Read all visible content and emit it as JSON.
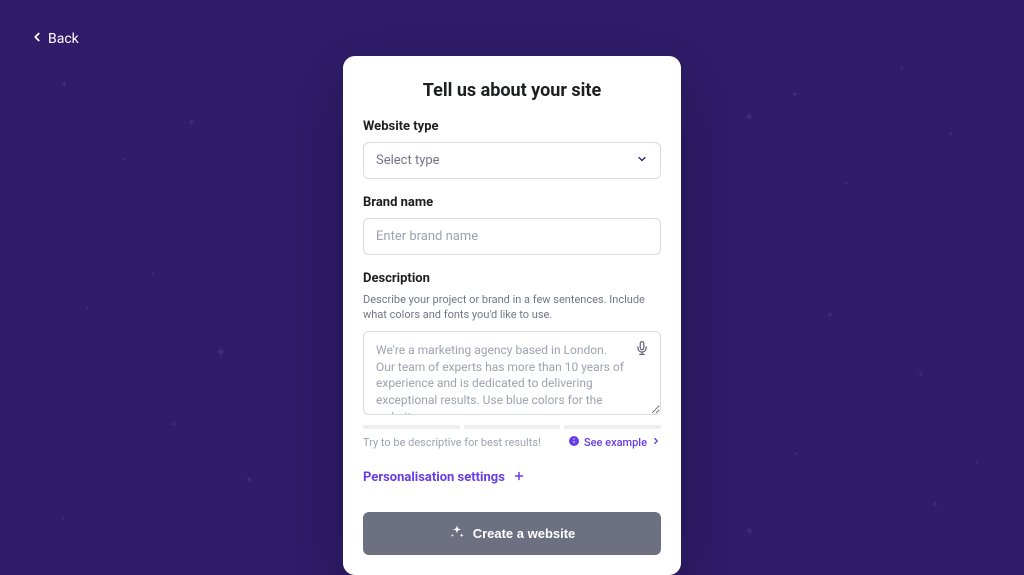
{
  "back_label": "Back",
  "card": {
    "title": "Tell us about your site",
    "website_type": {
      "label": "Website type",
      "placeholder": "Select type"
    },
    "brand_name": {
      "label": "Brand name",
      "placeholder": "Enter brand name"
    },
    "description": {
      "label": "Description",
      "sublabel": "Describe your project or brand in a few sentences. Include what colors and fonts you'd like to use.",
      "placeholder": "We're a marketing agency based in London. Our team of experts has more than 10 years of experience and is dedicated to delivering exceptional results. Use blue colors for the website...",
      "hint": "Try to be descriptive for best results!",
      "see_example": "See example"
    },
    "personalisation_label": "Personalisation settings",
    "create_button": "Create a website"
  }
}
